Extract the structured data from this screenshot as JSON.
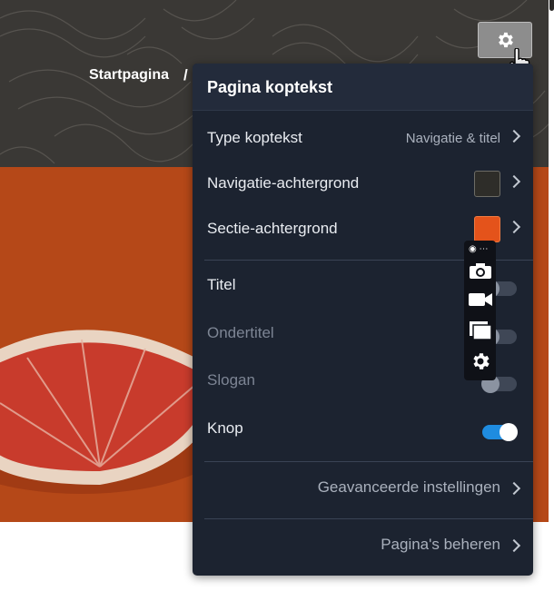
{
  "breadcrumb": {
    "home_label": "Startpagina",
    "separator": "/"
  },
  "panel": {
    "title": "Pagina koptekst",
    "header_type": {
      "label": "Type koptekst",
      "value": "Navigatie & titel"
    },
    "nav_background": {
      "label": "Navigatie-achtergrond"
    },
    "section_background": {
      "label": "Sectie-achtergrond"
    },
    "toggles": [
      {
        "label": "Titel",
        "state": "off"
      },
      {
        "label": "Ondertitel",
        "state": "off"
      },
      {
        "label": "Slogan",
        "state": "off"
      },
      {
        "label": "Knop",
        "state": "on"
      }
    ],
    "advanced_settings": "Geavanceerde instellingen",
    "manage_pages": "Pagina's beheren"
  },
  "colors": {
    "accent": "#1f8ce0",
    "panel_bg": "#1c2330",
    "hero": "#b54818",
    "header_bg": "#3a3835"
  },
  "icons": [
    "gear-icon",
    "pointer-cursor-icon",
    "chevron-right-icon",
    "camera-icon",
    "video-icon",
    "window-icon",
    "settings-icon"
  ]
}
